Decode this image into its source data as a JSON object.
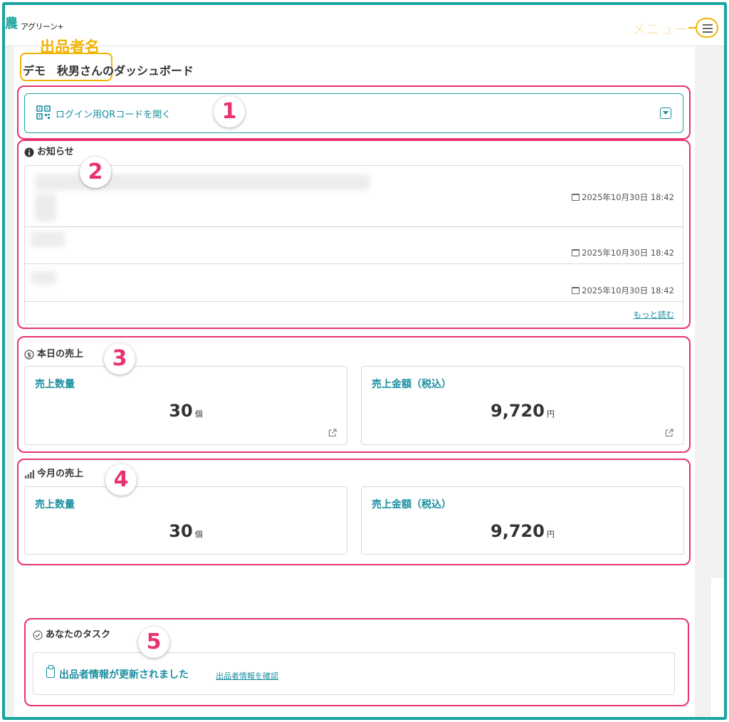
{
  "header": {
    "logo_text": "アグリーン+",
    "menu_annotation": "メニュー"
  },
  "annotations": {
    "seller_name_callout": "出品者名",
    "markers": [
      "1",
      "2",
      "3",
      "4",
      "5"
    ]
  },
  "page": {
    "title": "デモ　秋男さんのダッシュボード"
  },
  "qr": {
    "label": "ログイン用QRコードを開く"
  },
  "notices": {
    "title": "お知らせ",
    "items": [
      {
        "date": "2025年10月30日 18:42"
      },
      {
        "date": "2025年10月30日 18:42"
      },
      {
        "date": "2025年10月30日 18:42"
      }
    ],
    "more_label": "もっと読む"
  },
  "today_sales": {
    "title": "本日の売上",
    "quantity": {
      "label": "売上数量",
      "value": "30",
      "unit": "個"
    },
    "amount": {
      "label": "売上金額（税込）",
      "value": "9,720",
      "unit": "円"
    }
  },
  "month_sales": {
    "title": "今月の売上",
    "quantity": {
      "label": "売上数量",
      "value": "30",
      "unit": "個"
    },
    "amount": {
      "label": "売上金額（税込）",
      "value": "9,720",
      "unit": "円"
    }
  },
  "tasks": {
    "title": "あなたのタスク",
    "items": [
      {
        "text": "出品者情報が更新されました",
        "link": "出品者情報を確認"
      }
    ]
  },
  "colors": {
    "accent": "#1aa5a0",
    "link": "#1a8fa0",
    "highlight": "#e8336f",
    "callout": "#f0b400"
  }
}
